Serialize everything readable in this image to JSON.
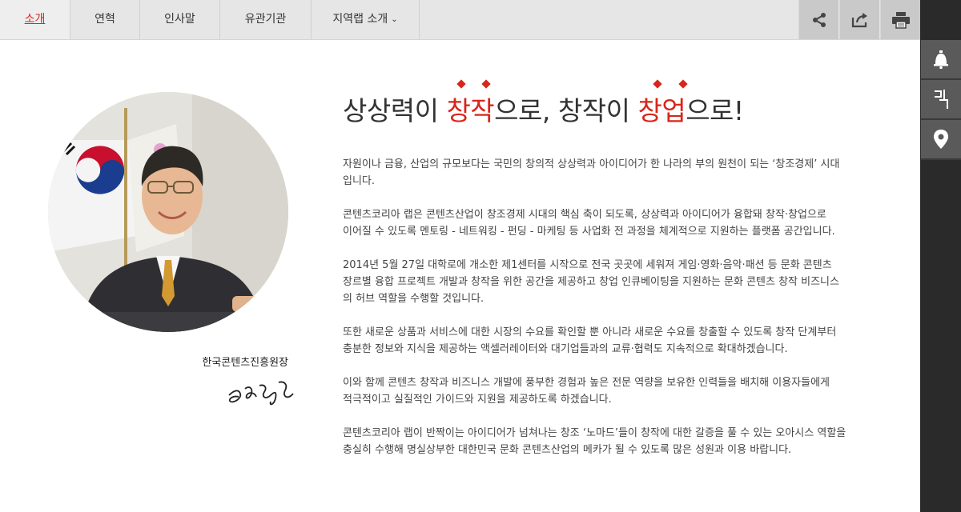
{
  "nav": {
    "tabs": [
      {
        "label": "소개"
      },
      {
        "label": "연혁"
      },
      {
        "label": "인사말"
      },
      {
        "label": "유관기관"
      },
      {
        "label": "지역랩 소개"
      }
    ],
    "tools": {
      "share": "share-icon",
      "export": "export-icon",
      "print": "print-icon"
    }
  },
  "rail": [
    "bell-icon",
    "building-icon",
    "location-pin-icon"
  ],
  "profile": {
    "org_title": "한국콘텐츠진흥원장",
    "signature": "signature"
  },
  "headline": {
    "part1": "상상력이 ",
    "hl1": "창작",
    "part2": "으로, 창작이 ",
    "hl2": "창업",
    "part3": "으로!"
  },
  "paragraphs": [
    [
      "자원이나 금융, 산업의 규모보다는 국민의 창의적 상상력과 아이디어가 한 나라의 부의 원천이 되는 ‘창조경제’ 시대",
      "입니다."
    ],
    [
      "콘텐츠코리아 랩은 콘텐츠산업이 창조경제 시대의 핵심 축이 되도록, 상상력과 아이디어가 융합돼 창작·창업으로",
      "이어질 수 있도록 멘토링 - 네트워킹 - 펀딩 - 마케팅 등 사업화 전 과정을 체계적으로 지원하는 플랫폼 공간입니다."
    ],
    [
      "2014년 5월 27일 대학로에 개소한 제1센터를 시작으로 전국 곳곳에 세워져 게임·영화·음악·패션 등 문화 콘텐츠",
      "장르별 융합 프로젝트 개발과 창작을 위한 공간을 제공하고 창업 인큐베이팅을 지원하는 문화 콘텐츠 창작 비즈니스",
      "의 허브 역할을 수행할 것입니다."
    ],
    [
      "또한 새로운 상품과 서비스에 대한 시장의 수요를 확인할 뿐 아니라 새로운 수요를 창출할 수 있도록 창작 단계부터",
      "충분한 정보와 지식을 제공하는 액셀러레이터와 대기업들과의 교류·협력도 지속적으로 확대하겠습니다."
    ],
    [
      "이와 함께 콘텐츠 창작과 비즈니스 개발에 풍부한 경험과 높은 전문 역량을 보유한 인력들을 배치해 이용자들에게",
      "적극적이고 실질적인 가이드와 지원을 제공하도록 하겠습니다."
    ],
    [
      "콘텐츠코리아 랩이 반짝이는 아이디어가 넘쳐나는 창조 ‘노마드’들이 창작에 대한 갈증을 풀 수 있는 오아시스 역할을",
      "충실히 수행해 명실상부한 대한민국 문화 콘텐츠산업의 메카가 될 수 있도록 많은 성원과 이용 바랍니다."
    ]
  ],
  "colors": {
    "accent": "#d7261b",
    "nav_bg": "#e6e6e6",
    "rail_bg": "#2a2a2a"
  }
}
